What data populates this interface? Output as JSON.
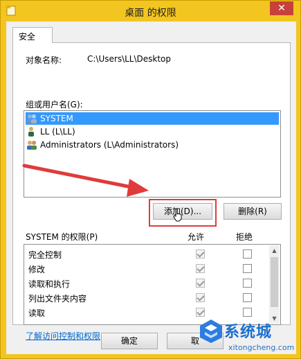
{
  "window": {
    "title": "桌面 的权限",
    "close_glyph": "✕"
  },
  "tabs": [
    {
      "label": "安全"
    }
  ],
  "object": {
    "label": "对象名称:",
    "value": "C:\\Users\\LL\\Desktop"
  },
  "groups": {
    "label": "组或用户名(G):",
    "items": [
      {
        "name": "SYSTEM",
        "selected": true
      },
      {
        "name": "LL (L\\LL)",
        "selected": false
      },
      {
        "name": "Administrators (L\\Administrators)",
        "selected": false
      }
    ]
  },
  "buttons": {
    "add": "添加(D)...",
    "remove": "删除(R)",
    "ok": "确定",
    "cancel": "取"
  },
  "permissions": {
    "label": "SYSTEM 的权限(P)",
    "allow_header": "允许",
    "deny_header": "拒绝",
    "rows": [
      {
        "name": "完全控制",
        "allow": true,
        "deny": false
      },
      {
        "name": "修改",
        "allow": true,
        "deny": false
      },
      {
        "name": "读取和执行",
        "allow": true,
        "deny": false
      },
      {
        "name": "列出文件夹内容",
        "allow": true,
        "deny": false
      },
      {
        "name": "读取",
        "allow": true,
        "deny": false
      }
    ]
  },
  "link": "了解访问控制和权限",
  "watermark": {
    "text": "系统城",
    "sub": "xitongcheng.com"
  },
  "colors": {
    "accent": "#3399ff",
    "titlebar": "#f3c520",
    "close": "#c7413a",
    "annotation": "#e03b3b"
  }
}
